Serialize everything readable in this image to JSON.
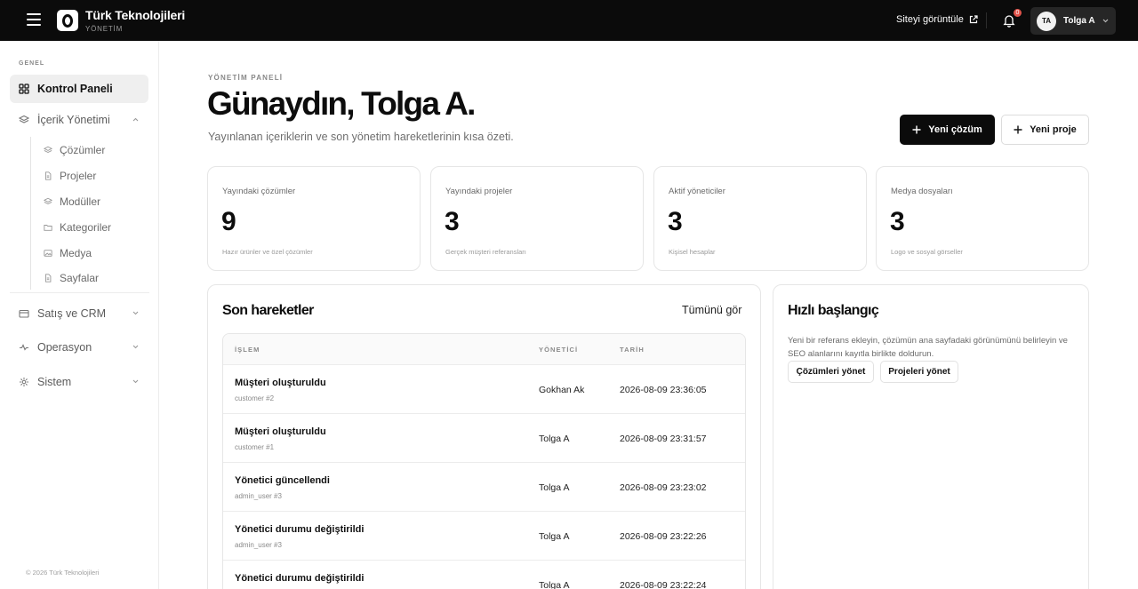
{
  "header": {
    "brand_name": "Türk Teknolojileri",
    "brand_sub": "YÖNETİM",
    "view_site": "Siteyi görüntüle",
    "notification_count": "0",
    "user_initials": "TA",
    "user_name": "Tolga A"
  },
  "sidebar": {
    "section_label": "GENEL",
    "items": [
      {
        "label": "Kontrol Paneli",
        "icon": "grid-icon"
      },
      {
        "label": "İçerik Yönetimi",
        "icon": "layers-icon"
      },
      {
        "label": "Satış ve CRM",
        "icon": "wallet-icon"
      },
      {
        "label": "Operasyon",
        "icon": "activity-icon"
      },
      {
        "label": "Sistem",
        "icon": "gear-icon"
      }
    ],
    "sub_items": [
      {
        "label": "Çözümler",
        "icon": "layers-icon"
      },
      {
        "label": "Projeler",
        "icon": "file-icon"
      },
      {
        "label": "Modüller",
        "icon": "layers-icon"
      },
      {
        "label": "Kategoriler",
        "icon": "folder-icon"
      },
      {
        "label": "Medya",
        "icon": "image-icon"
      },
      {
        "label": "Sayfalar",
        "icon": "file-icon"
      }
    ],
    "copyright": "© 2026 Türk Teknolojileri"
  },
  "main": {
    "eyebrow": "YÖNETİM PANELİ",
    "greeting": "Günaydın, Tolga A.",
    "subtitle": "Yayınlanan içeriklerin ve son yönetim hareketlerinin kısa özeti.",
    "primary_button": "Yeni çözüm",
    "secondary_button": "Yeni proje"
  },
  "stats": [
    {
      "label": "Yayındaki çözümler",
      "value": "9",
      "note": "Hazır ürünler ve özel çözümler"
    },
    {
      "label": "Yayındaki projeler",
      "value": "3",
      "note": "Gerçek müşteri referansları"
    },
    {
      "label": "Aktif yöneticiler",
      "value": "3",
      "note": "Kişisel hesaplar"
    },
    {
      "label": "Medya dosyaları",
      "value": "3",
      "note": "Logo ve sosyal görseller"
    }
  ],
  "recent": {
    "title": "Son hareketler",
    "see_all": "Tümünü gör",
    "columns": [
      "İŞLEM",
      "YÖNETİCİ",
      "TARİH"
    ],
    "rows": [
      {
        "op": "Müşteri oluşturuldu",
        "ref": "customer #2",
        "who": "Gokhan Ak",
        "when": "2026-08-09 23:36:05"
      },
      {
        "op": "Müşteri oluşturuldu",
        "ref": "customer #1",
        "who": "Tolga A",
        "when": "2026-08-09 23:31:57"
      },
      {
        "op": "Yönetici güncellendi",
        "ref": "admin_user #3",
        "who": "Tolga A",
        "when": "2026-08-09 23:23:02"
      },
      {
        "op": "Yönetici durumu değiştirildi",
        "ref": "admin_user #3",
        "who": "Tolga A",
        "when": "2026-08-09 23:22:26"
      },
      {
        "op": "Yönetici durumu değiştirildi",
        "ref": "",
        "who": "Tolga A",
        "when": "2026-08-09 23:22:24"
      }
    ]
  },
  "quick_start": {
    "title": "Hızlı başlangıç",
    "text": "Yeni bir referans ekleyin, çözümün ana sayfadaki görünümünü belirleyin ve SEO alanlarını kayıtla birlikte doldurun.",
    "button_solutions": "Çözümleri yönet",
    "button_projects": "Projeleri yönet"
  }
}
